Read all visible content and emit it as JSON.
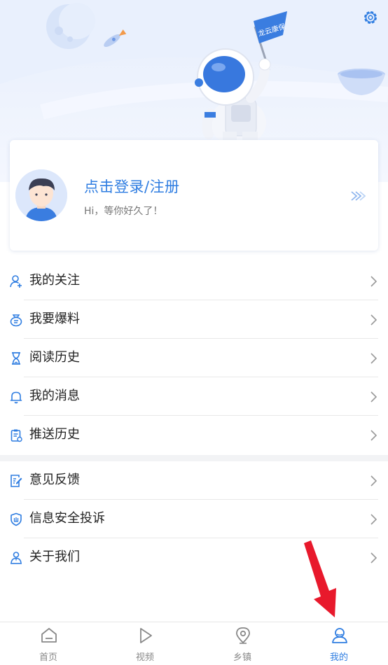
{
  "hero": {
    "flag_text": "龙云康保",
    "settings_icon": "gear-icon"
  },
  "login": {
    "title": "点击登录/注册",
    "subtitle": "Hi，等你好久了！",
    "avatar_icon": "default-avatar-icon",
    "arrow_icon": "double-chevron-right-icon"
  },
  "menu_group_1": [
    {
      "label": "我的关注",
      "icon": "user-add-icon"
    },
    {
      "label": "我要爆料",
      "icon": "report-bag-icon"
    },
    {
      "label": "阅读历史",
      "icon": "hourglass-icon"
    },
    {
      "label": "我的消息",
      "icon": "bell-icon"
    },
    {
      "label": "推送历史",
      "icon": "clipboard-icon"
    }
  ],
  "menu_group_2": [
    {
      "label": "意见反馈",
      "icon": "feedback-icon"
    },
    {
      "label": "信息安全投诉",
      "icon": "shield-icon"
    },
    {
      "label": "关于我们",
      "icon": "about-us-icon"
    }
  ],
  "tabbar": [
    {
      "label": "首页",
      "icon": "home-icon",
      "active": false
    },
    {
      "label": "视频",
      "icon": "play-icon",
      "active": false
    },
    {
      "label": "乡镇",
      "icon": "location-pin-icon",
      "active": false
    },
    {
      "label": "我的",
      "icon": "profile-icon",
      "active": true
    }
  ],
  "colors": {
    "accent": "#2f7de1",
    "annotation_arrow": "#e8192c"
  }
}
